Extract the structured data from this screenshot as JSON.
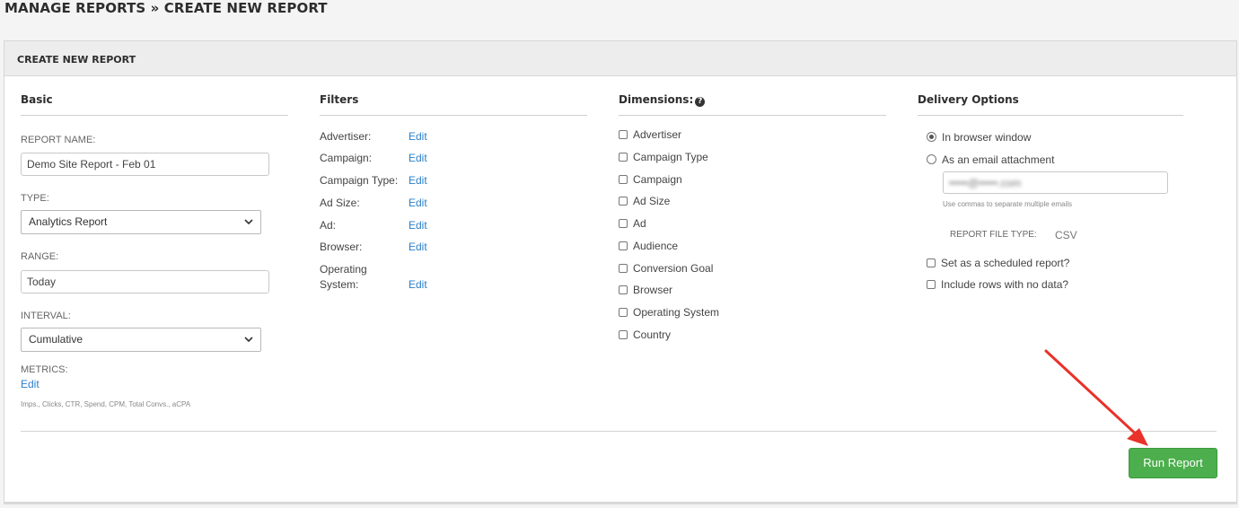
{
  "breadcrumb": "MANAGE REPORTS » CREATE NEW REPORT",
  "panel_title": "CREATE NEW REPORT",
  "basic": {
    "heading": "Basic",
    "report_name_label": "REPORT NAME:",
    "report_name_value": "Demo Site Report - Feb 01",
    "type_label": "TYPE:",
    "type_value": "Analytics Report",
    "range_label": "RANGE:",
    "range_value": "Today",
    "interval_label": "INTERVAL:",
    "interval_value": "Cumulative",
    "metrics_label": "METRICS:",
    "metrics_edit": "Edit",
    "metrics_summary": "Imps., Clicks, CTR, Spend, CPM, Total Convs., aCPA"
  },
  "filters": {
    "heading": "Filters",
    "items": [
      {
        "label": "Advertiser:",
        "edit": "Edit"
      },
      {
        "label": "Campaign:",
        "edit": "Edit"
      },
      {
        "label": "Campaign Type:",
        "edit": "Edit"
      },
      {
        "label": "Ad Size:",
        "edit": "Edit"
      },
      {
        "label": "Ad:",
        "edit": "Edit"
      },
      {
        "label": "Browser:",
        "edit": "Edit"
      },
      {
        "label": "Operating",
        "label2": "System:",
        "edit": "Edit"
      }
    ]
  },
  "dimensions": {
    "heading": "Dimensions:",
    "help_glyph": "?",
    "items": [
      "Advertiser",
      "Campaign Type",
      "Campaign",
      "Ad Size",
      "Ad",
      "Audience",
      "Conversion Goal",
      "Browser",
      "Operating System",
      "Country"
    ]
  },
  "delivery": {
    "heading": "Delivery Options",
    "radio_browser": "In browser window",
    "radio_email": "As an email attachment",
    "email_value": "•••••@•••••.com",
    "email_hint": "Use commas to separate multiple emails",
    "file_type_label": "REPORT FILE TYPE:",
    "file_type_value": "CSV",
    "scheduled_label": "Set as a scheduled report?",
    "no_data_label": "Include rows with no data?"
  },
  "run_button": "Run Report",
  "colors": {
    "link": "#2a7fc8",
    "run_button": "#4cae4c",
    "arrow": "#e8322a"
  }
}
